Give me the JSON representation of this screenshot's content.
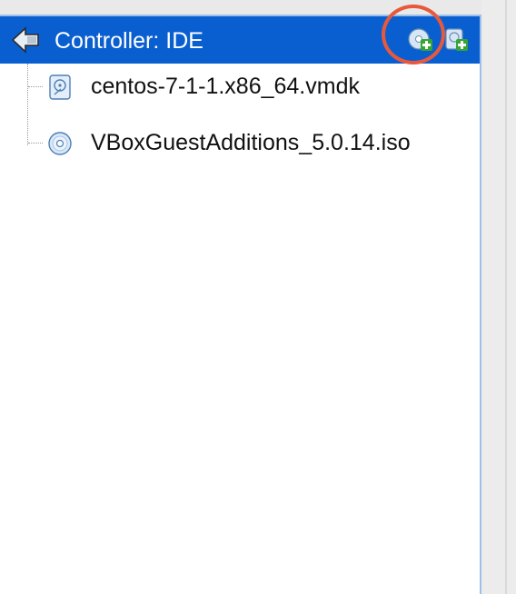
{
  "controller": {
    "title": "Controller: IDE",
    "icon": "ide-controller-icon",
    "actions": [
      {
        "name": "add-optical-drive",
        "icon": "add-optical-drive-icon"
      },
      {
        "name": "add-hard-disk",
        "icon": "add-hard-disk-icon"
      }
    ]
  },
  "attachments": [
    {
      "label": "centos-7-1-1.x86_64.vmdk",
      "icon": "hard-disk-icon"
    },
    {
      "label": "VBoxGuestAdditions_5.0.14.iso",
      "icon": "optical-disc-icon"
    }
  ],
  "colors": {
    "header_bg": "#0a5fd0",
    "highlight": "#e8593c",
    "panel_border": "#9cc0e8"
  }
}
